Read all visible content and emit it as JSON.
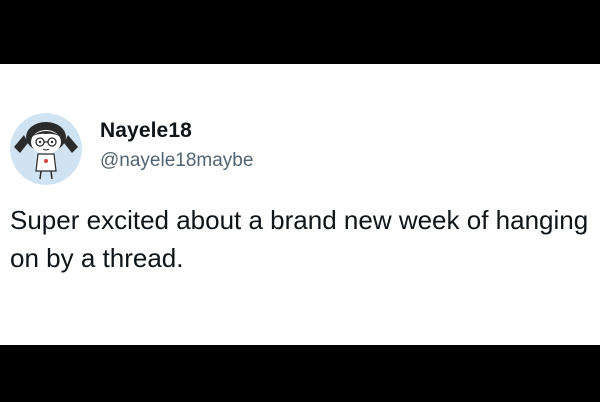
{
  "tweet": {
    "display_name": "Nayele18",
    "handle": "@nayele18maybe",
    "text": "Super excited about a brand new week of hanging on by a thread.",
    "avatar_icon": "cartoon-girl-avatar"
  },
  "colors": {
    "letterbox": "#000000",
    "card_background": "#ffffff",
    "name_text": "#0f1419",
    "handle_text": "#536471",
    "avatar_background": "#cfe3f2"
  }
}
